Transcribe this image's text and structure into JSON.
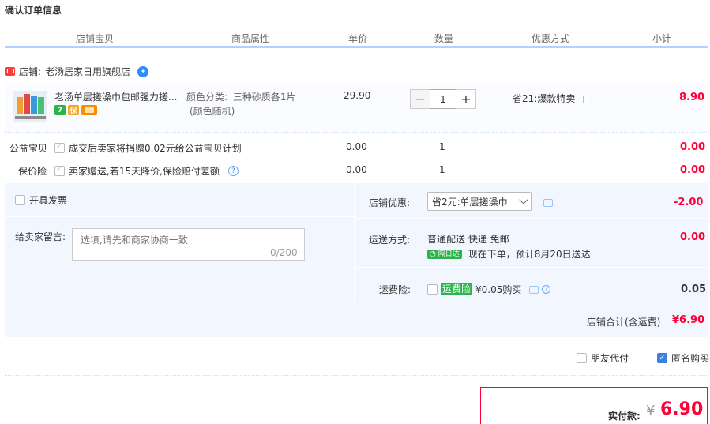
{
  "page_title": "确认订单信息",
  "columns": [
    "店铺宝贝",
    "商品属性",
    "单价",
    "数量",
    "优惠方式",
    "小计"
  ],
  "shop": {
    "label": "店铺:",
    "name": "老汤居家日用旗舰店"
  },
  "item": {
    "title": "老汤单层搓澡巾包邮强力搓...",
    "attr_label": "颜色分类:",
    "attr_value": "三种砂质各1片",
    "attr_note": "(颜色随机)",
    "price": "29.90",
    "quantity": "1",
    "promo": "省21:爆款特卖",
    "subtotal": "8.90",
    "tags": [
      {
        "text": "7",
        "color": "#2cb34a",
        "icon": "seven-day-return-icon"
      },
      {
        "text": "保",
        "color": "#f5a623",
        "icon": "guarantee-icon"
      },
      {
        "text": "",
        "color": "#ff8a00",
        "icon": "card-icon"
      }
    ]
  },
  "extras": [
    {
      "label": "公益宝贝",
      "desc": "成交后卖家将捐赠0.02元给公益宝贝计划",
      "price": "0.00",
      "qty": "1",
      "subtotal": "0.00"
    },
    {
      "label": "保价险",
      "desc": "卖家赠送,若15天降价,保险赔付差额",
      "price": "0.00",
      "qty": "1",
      "subtotal": "0.00"
    }
  ],
  "invoice_label": "开具发票",
  "memo": {
    "label": "给卖家留言:",
    "placeholder": "选填,请先和商家协商一致",
    "counter": "0/200"
  },
  "shop_discount": {
    "label": "店铺优惠:",
    "selected": "省2元:单层搓澡巾",
    "amount": "-2.00"
  },
  "shipping": {
    "label": "运送方式:",
    "method": "普通配送 快递 免邮",
    "badge": "隔日达",
    "eta": "现在下单，预计8月20日送达",
    "amount": "0.00"
  },
  "freight_insurance": {
    "label": "运费险:",
    "tag": "运费险",
    "price_text": "¥0.05购买",
    "amount": "0.05"
  },
  "shop_total": {
    "label": "店铺合计(含运费)",
    "amount": "¥6.90"
  },
  "options": {
    "friend_pay": "朋友代付",
    "anonymous": "匿名购买"
  },
  "actual_pay": {
    "label": "实付款:",
    "currency": "¥",
    "amount": "6.90"
  },
  "colors": {
    "accent_red": "#ff0036",
    "panel_bg": "#f2f7ff",
    "header_line": "#b2d1ff",
    "blue": "#3d7fe0"
  }
}
